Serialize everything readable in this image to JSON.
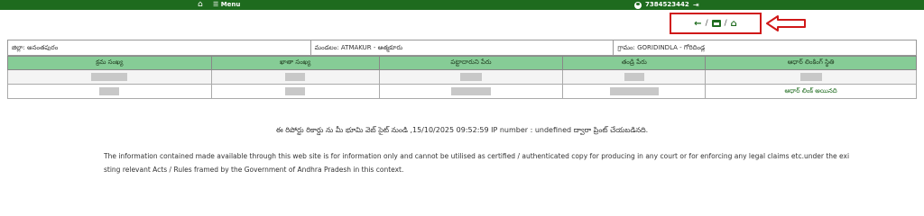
{
  "topbar": {
    "menu_label": "Menu",
    "phone": "7384523442"
  },
  "actions": {
    "separator": "/"
  },
  "info": {
    "district_label": "జిల్లా:",
    "district_value": "అనంతపురం",
    "mandal_label": "మండలం:",
    "mandal_value": "ATMAKUR - ఆత్మకూరు",
    "village_label": "గ్రామం:",
    "village_value": "GORIDINDLA - గోరిదిండ్ల"
  },
  "table": {
    "headers": [
      "క్రమ సంఖ్య",
      "ఖాతా సంఖ్య",
      "పట్టాదారుని పేరు",
      "తండ్రి పేరు",
      "ఆధార్ లింకింగ్ స్థితి"
    ],
    "row2_status": "ఆధార్ లింక్ అయినది"
  },
  "generated_text": "ఈ రిపోర్టు రికార్డు ను మీ భూమి వెబ్ సైట్ నుండి ,15/10/2025 09:52:59 IP number : undefined ద్వారా ప్రింట్ చేయబడినది.",
  "disclaimer_line1": "The information contained made available through this web site is for information only and cannot be utilised as certified / authenticated copy for producing in any court or for enforcing any legal claims etc.under the exi",
  "disclaimer_line2": "sting relevant Acts / Rules framed by the Government of Andhra Pradesh in this context.",
  "colors": {
    "topbar": "#1e6b1e",
    "table_header": "#86cc96",
    "highlight": "#d01818"
  }
}
